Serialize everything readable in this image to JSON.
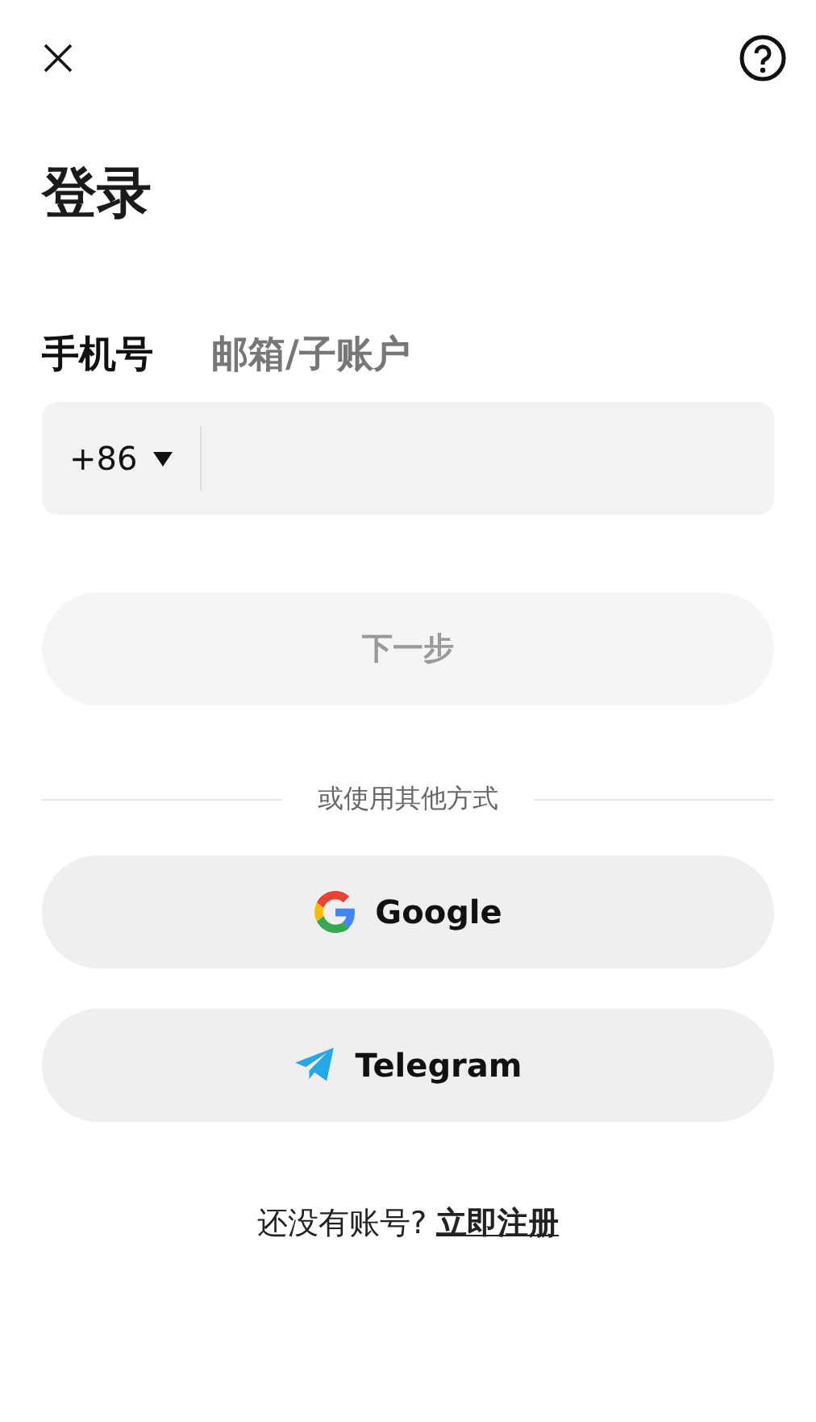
{
  "title": "登录",
  "tabs": [
    {
      "label": "手机号",
      "selected": true
    },
    {
      "label": "邮箱/子账户",
      "selected": false
    }
  ],
  "phone_field": {
    "country_code": "+86"
  },
  "next_button": {
    "label": "下一步",
    "disabled": true
  },
  "divider_text": "或使用其他方式",
  "social_buttons": [
    {
      "kind": "google",
      "label": "Google"
    },
    {
      "kind": "telegram",
      "label": "Telegram"
    }
  ],
  "footer": {
    "text": "还没有账号?",
    "link": "立即注册"
  }
}
